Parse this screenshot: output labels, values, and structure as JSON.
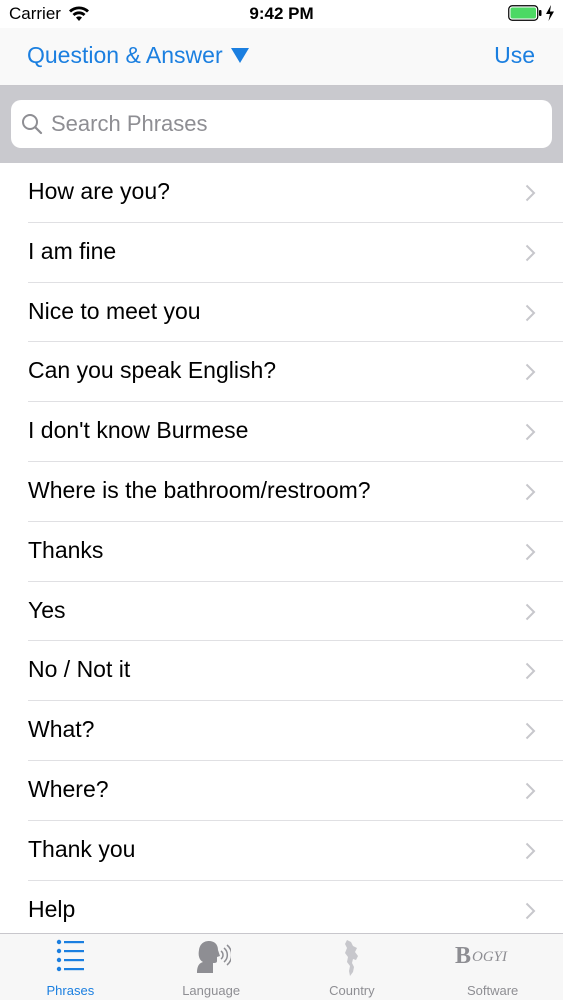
{
  "status_bar": {
    "carrier": "Carrier",
    "time": "9:42 PM",
    "battery_color": "#4cd964"
  },
  "nav": {
    "title": "Question & Answer",
    "right_button": "Use",
    "accent_color": "#1b7fe0"
  },
  "search": {
    "placeholder": "Search Phrases",
    "value": ""
  },
  "phrases": [
    "How are you?",
    "I am fine",
    "Nice to meet you",
    "Can you speak English?",
    "I don't know Burmese",
    "Where is the bathroom/restroom?",
    "Thanks",
    "Yes",
    "No / Not it",
    "What?",
    "Where?",
    "Thank you",
    "Help"
  ],
  "tabs": [
    {
      "label": "Phrases",
      "icon": "list-icon",
      "active": true
    },
    {
      "label": "Language",
      "icon": "speaking-head-icon",
      "active": false
    },
    {
      "label": "Country",
      "icon": "country-map-icon",
      "active": false
    },
    {
      "label": "Software",
      "icon": "bogyi-logo-icon",
      "active": false
    }
  ],
  "tab_logo_text": "BOGYI"
}
